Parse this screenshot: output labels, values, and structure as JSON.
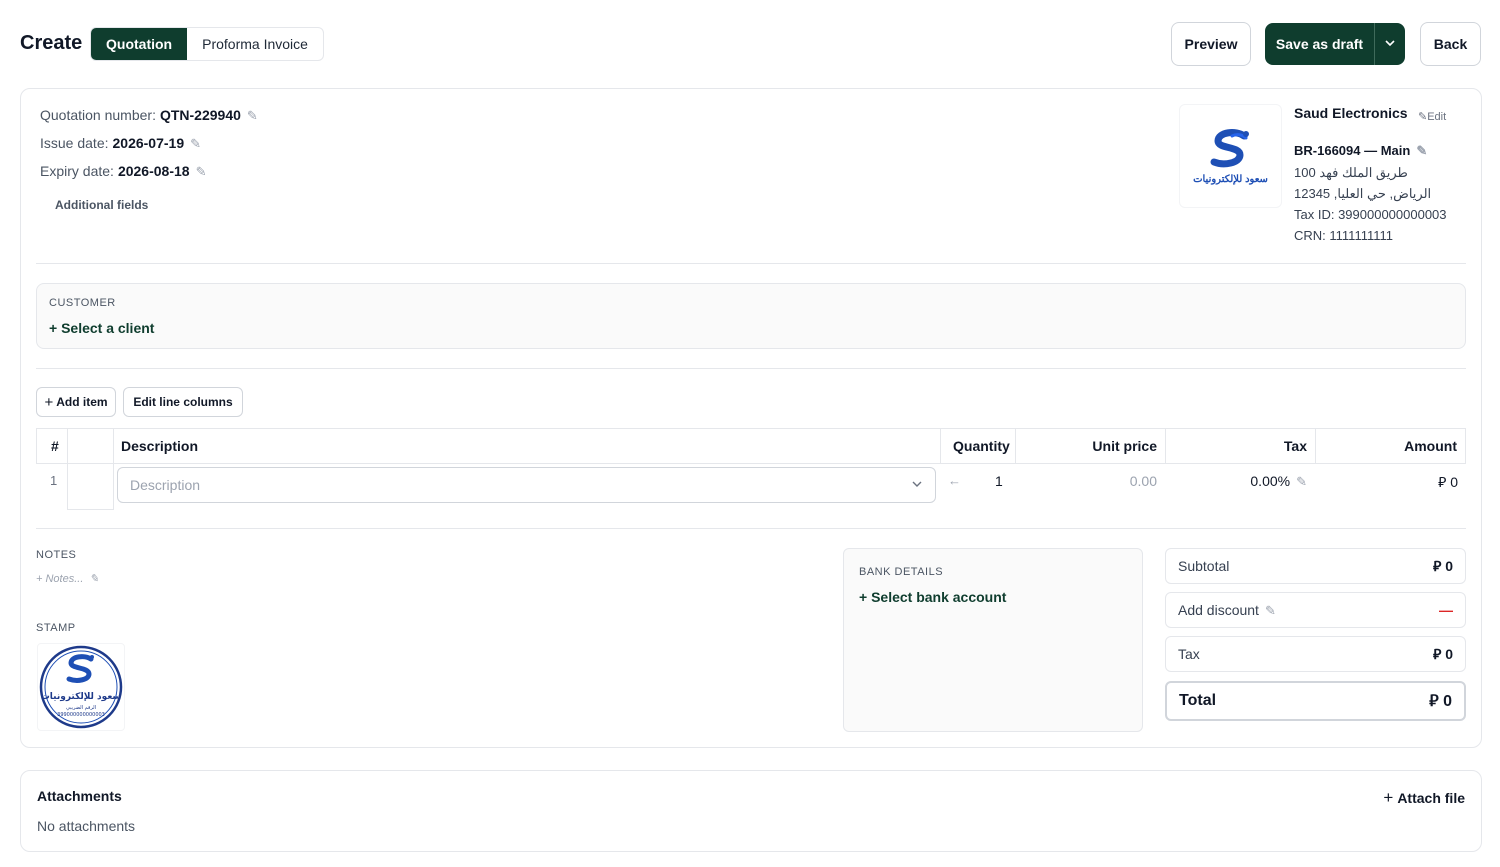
{
  "header": {
    "title": "Create",
    "doc_types": [
      "Quotation",
      "Proforma Invoice"
    ],
    "active_type": "Quotation",
    "preview_label": "Preview",
    "save_label": "Save as draft",
    "back_label": "Back"
  },
  "document": {
    "number_label": "Quotation number:",
    "number": "QTN-229940",
    "issue_label": "Issue date:",
    "issue_date": "2026-07-19",
    "expiry_label": "Expiry date:",
    "expiry_date": "2026-08-18",
    "additional_fields_label": "Additional fields"
  },
  "company": {
    "name": "Saud Electronics",
    "edit_label": "Edit",
    "branch": "BR-166094 — Main",
    "address_line1": "100 طريق الملك فهد",
    "address_line2": "الرياض, حي العليا, 12345",
    "tax_id": "Tax ID: 399000000000003",
    "crn": "CRN: 1111111111",
    "logo_text": "سعود للإلكترونيات"
  },
  "customer": {
    "label": "CUSTOMER",
    "select_label": "+ Select a client"
  },
  "items": {
    "add_item_label": "Add item",
    "edit_columns_label": "Edit line columns",
    "columns": {
      "index": "#",
      "description": "Description",
      "quantity": "Quantity",
      "unit_price": "Unit price",
      "tax": "Tax",
      "amount": "Amount"
    },
    "rows": [
      {
        "index": "1",
        "description_placeholder": "Description",
        "quantity": "1",
        "unit_price": "0.00",
        "tax": "0.00%",
        "amount": "0"
      }
    ]
  },
  "notes": {
    "label": "NOTES",
    "placeholder": "+ Notes..."
  },
  "stamp": {
    "label": "STAMP",
    "stamp_name": "سعود للإلكترونيات",
    "stamp_sub": "الرقم الضريبي",
    "stamp_number": "399000000000003"
  },
  "bank": {
    "label": "BANK DETAILS",
    "select_label": "+ Select bank account"
  },
  "totals": {
    "subtotal_label": "Subtotal",
    "subtotal": "0",
    "discount_label": "Add discount",
    "discount_value": "—",
    "tax_label": "Tax",
    "tax": "0",
    "total_label": "Total",
    "total": "0",
    "currency_symbol": "⃁"
  },
  "attachments": {
    "title": "Attachments",
    "attach_label": "Attach file",
    "empty_text": "No attachments"
  },
  "colors": {
    "brand": "#0f3d2e",
    "accent_blue": "#1e4fb5",
    "danger": "#dc2626"
  }
}
